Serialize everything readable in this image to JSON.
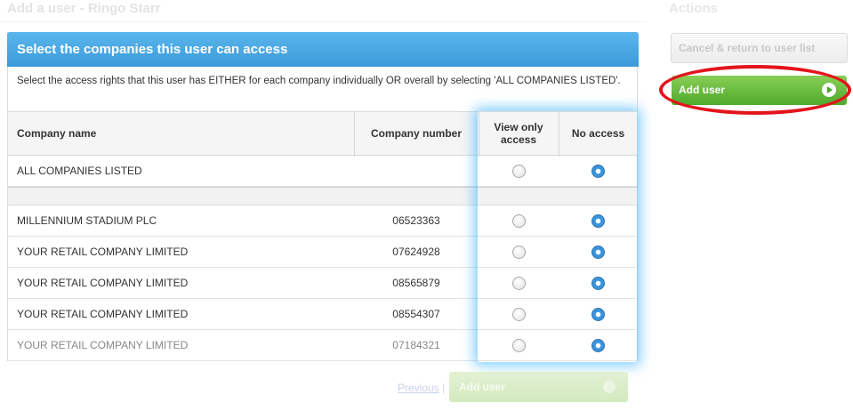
{
  "page": {
    "title": "Add a user - Ringo Starr",
    "actions_title": "Actions"
  },
  "panel": {
    "header": "Select the companies this user can access",
    "instructions": "Select the access rights that this user has EITHER for each company individually OR overall by selecting 'ALL COMPANIES LISTED'."
  },
  "table": {
    "headers": {
      "company_name": "Company name",
      "company_number": "Company number",
      "view_only": "View only access",
      "no_access": "No access"
    },
    "all_row": {
      "name": "ALL COMPANIES LISTED",
      "number": "",
      "selected": "no_access"
    },
    "rows": [
      {
        "name": "MILLENNIUM STADIUM PLC",
        "number": "06523363",
        "selected": "no_access"
      },
      {
        "name": "YOUR RETAIL COMPANY LIMITED",
        "number": "07624928",
        "selected": "no_access"
      },
      {
        "name": "YOUR RETAIL COMPANY LIMITED",
        "number": "08565879",
        "selected": "no_access"
      },
      {
        "name": "YOUR RETAIL COMPANY LIMITED",
        "number": "08554307",
        "selected": "no_access"
      },
      {
        "name": "YOUR RETAIL COMPANY LIMITED",
        "number": "07184321",
        "selected": "no_access"
      }
    ]
  },
  "pager": {
    "previous": "Previous",
    "separator": "|"
  },
  "actions": {
    "cancel_label": "Cancel & return to user list",
    "add_user_label": "Add user",
    "bottom_add_user_label": "Add user"
  },
  "colors": {
    "header_blue": "#3b9ad9",
    "add_green": "#4ea92a",
    "highlight_red": "#e3141b",
    "glow_blue": "#3cb4ff"
  },
  "icons": {
    "go": "play-circle-icon",
    "radio": "radio-button"
  }
}
